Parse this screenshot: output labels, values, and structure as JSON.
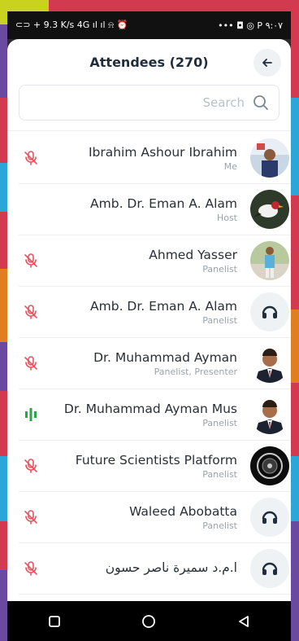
{
  "status": {
    "left_icons": "⊂⊃ + 9.3 K/s 4G ıl ıl ⍾ ⏰",
    "right": "••• ◘ ◎ P ٩:٠٧"
  },
  "header": {
    "title": "Attendees (270)"
  },
  "search": {
    "placeholder": "Search"
  },
  "attendees": [
    {
      "name": "Ibrahim Ashour Ibrahim",
      "role": "Me",
      "mic": "muted",
      "avatar": "photo-man-blue"
    },
    {
      "name": "Amb. Dr. Eman A. Alam",
      "role": "Host",
      "mic": "none",
      "avatar": "photo-bird"
    },
    {
      "name": "Ahmed Yasser",
      "role": "Panelist",
      "mic": "muted",
      "avatar": "photo-man-standing"
    },
    {
      "name": "Amb. Dr. Eman A. Alam",
      "role": "Panelist",
      "mic": "muted",
      "avatar": "headphones"
    },
    {
      "name": "Dr. Muhammad Ayman",
      "role": "Panelist, Presenter",
      "mic": "muted",
      "avatar": "photo-man-suit"
    },
    {
      "name": "Dr. Muhammad Ayman Mus",
      "role": "Panelist",
      "mic": "active",
      "avatar": "photo-man-suit"
    },
    {
      "name": "Future Scientists Platform",
      "role": "Panelist",
      "mic": "muted",
      "avatar": "logo-dark"
    },
    {
      "name": "Waleed Abobatta",
      "role": "Panelist",
      "mic": "muted",
      "avatar": "headphones"
    },
    {
      "name": "ا.م.د سميرة ناصر حسون",
      "role": "",
      "mic": "muted",
      "avatar": "headphones"
    }
  ],
  "colors": {
    "muted": "#e5535f",
    "active": "#27a745",
    "accent": "#1f2d3d"
  }
}
